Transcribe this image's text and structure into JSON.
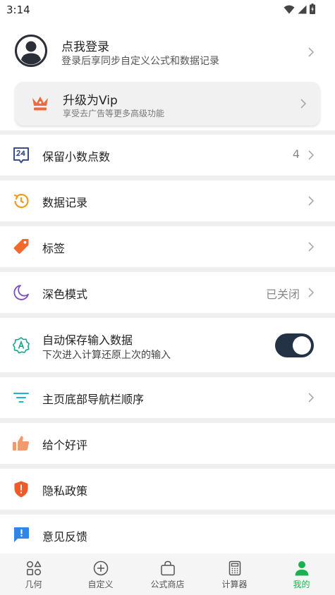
{
  "status_bar": {
    "time": "3:14"
  },
  "profile": {
    "title": "点我登录",
    "subtitle": "登录后享同步自定义公式和数据记录"
  },
  "vip": {
    "title": "升级为Vip",
    "subtitle": "享受去广告等更多高级功能"
  },
  "settings": {
    "decimal": {
      "label": "保留小数点数",
      "value": "4",
      "icon_name": "calendar-24-icon"
    },
    "history": {
      "label": "数据记录",
      "icon_name": "history-clock-icon"
    },
    "tags": {
      "label": "标签",
      "icon_name": "tag-icon"
    },
    "dark_mode": {
      "label": "深色模式",
      "value": "已关闭",
      "icon_name": "moon-icon"
    },
    "autosave": {
      "label": "自动保存输入数据",
      "subtitle": "下次进入计算还原上次的输入",
      "enabled": true,
      "icon_name": "badge-a-icon"
    },
    "nav_order": {
      "label": "主页底部导航栏顺序",
      "icon_name": "filter-lines-icon"
    },
    "rate": {
      "label": "给个好评",
      "icon_name": "thumbs-up-icon"
    },
    "privacy": {
      "label": "隐私政策",
      "icon_name": "shield-icon"
    },
    "feedback": {
      "label": "意见反馈",
      "icon_name": "feedback-bubble-icon"
    }
  },
  "tabs": [
    {
      "label": "几何",
      "icon_name": "shapes-icon",
      "active": false
    },
    {
      "label": "自定义",
      "icon_name": "add-circle-icon",
      "active": false
    },
    {
      "label": "公式商店",
      "icon_name": "shopping-bag-icon",
      "active": false
    },
    {
      "label": "计算器",
      "icon_name": "calculator-icon",
      "active": false
    },
    {
      "label": "我的",
      "icon_name": "person-icon",
      "active": true
    }
  ],
  "colors": {
    "accent_green": "#1db050",
    "vip_orange": "#ee6a3c",
    "toggle_on": "#243246",
    "history_orange": "#f39a1e",
    "tag_orange": "#f26a2a",
    "moon_purple": "#7a4fc2",
    "autosave_teal": "#14a58a",
    "nav_cyan": "#1ab7c9",
    "rate_orange": "#f39a6b",
    "privacy_orange": "#f05a28",
    "feedback_blue": "#2f86e6",
    "calendar_blue": "#3a4f8a"
  }
}
